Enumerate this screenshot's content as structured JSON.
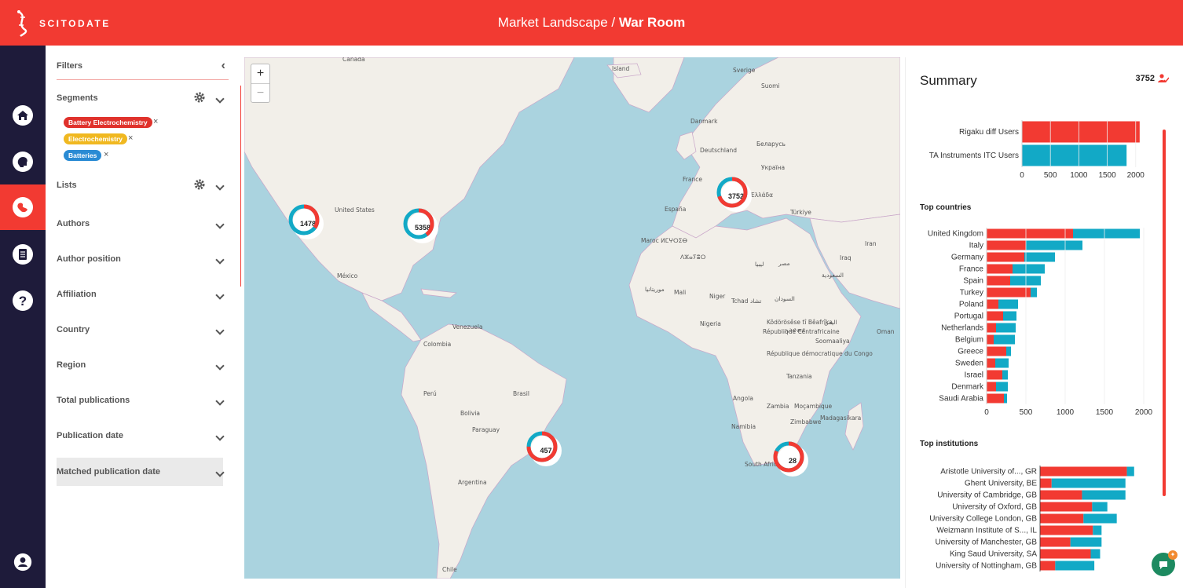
{
  "header": {
    "logo_text": "SCITODATE",
    "title_prefix": "Market Landscape / ",
    "title_main": "War Room"
  },
  "nav": {
    "items": [
      {
        "icon": "home-icon"
      },
      {
        "icon": "brain-icon"
      },
      {
        "icon": "globe-icon",
        "active": true
      },
      {
        "icon": "list-icon"
      },
      {
        "icon": "help-icon"
      },
      {
        "icon": "user-icon"
      }
    ]
  },
  "filters": {
    "title": "Filters",
    "collapse_symbol": "‹",
    "segments_label": "Segments",
    "tags": [
      {
        "label": "Battery Electrochemistry",
        "color": "#e0322c"
      },
      {
        "label": "Electrochemistry",
        "color": "#f0b820"
      },
      {
        "label": "Batteries",
        "color": "#2a8bd4"
      }
    ],
    "tag_remove": "×",
    "lists_label": "Lists",
    "rows": [
      "Authors",
      "Author position",
      "Affiliation",
      "Country",
      "Region",
      "Total publications",
      "Publication date"
    ],
    "matched_label": "Matched publication date"
  },
  "map": {
    "zoom_in": "+",
    "zoom_out": "−",
    "clusters": [
      {
        "value": "1478",
        "share": 0.35
      },
      {
        "value": "5358",
        "share": 0.4
      },
      {
        "value": "3752",
        "share": 0.7
      },
      {
        "value": "457",
        "share": 0.75
      },
      {
        "value": "28",
        "share": 0.82
      }
    ],
    "labels": [
      "Canada",
      "Island",
      "Sverige",
      "Suomi",
      "Danmark",
      "Deutschland",
      "Беларусь",
      "Україна",
      "France",
      "España",
      "Ελλάδα",
      "Türkiye",
      "United States",
      "México",
      "Maroc ⵍⵎⵖⵔⵉⴱ",
      "ⴷⵣⴰⵢⴻⵔ",
      "ليبيا",
      "مصر",
      "موريتانيا",
      "Mali",
      "Niger",
      "Tchad تشاد",
      "السودان",
      "السعودية",
      "اليمن",
      "Nigeria",
      "Kôdörösêse tî Bêafrîka",
      "République Centrafricaine",
      "ኢትዮጵያ",
      "Soomaaliya",
      "Venezuela",
      "Colombia",
      "Perú",
      "Brasil",
      "Bolivia",
      "Paraguay",
      "Argentina",
      "Chile",
      "République démocratique du Congo",
      "Tanzania",
      "Angola",
      "Zambia",
      "Moçambique",
      "Namibia",
      "Zimbabwe",
      "Madagasikara",
      "South Africa",
      "Iran",
      "Iraq",
      "Oman"
    ]
  },
  "summary": {
    "title": "Summary",
    "count": "3752",
    "colors": {
      "red": "#f23a32",
      "teal": "#12a9c6"
    },
    "users_chart": {
      "categories": [
        "Rigaku diff Users",
        "TA Instruments ITC Users"
      ],
      "values": [
        2070,
        1840
      ],
      "ticks": [
        0,
        500,
        1000,
        1500,
        2000
      ]
    },
    "countries_title": "Top countries",
    "institutions_title": "Top institutions"
  },
  "chart_data": [
    {
      "type": "bar",
      "categories": [
        "Rigaku diff Users",
        "TA Instruments ITC Users"
      ],
      "values": [
        2070,
        1840
      ],
      "xlim": [
        0,
        2100
      ]
    },
    {
      "type": "bar",
      "title": "Top countries",
      "categories": [
        "United Kingdom",
        "Italy",
        "Germany",
        "France",
        "Spain",
        "Turkey",
        "Poland",
        "Portugal",
        "Netherlands",
        "Belgium",
        "Greece",
        "Sweden",
        "Israel",
        "Denmark",
        "Saudi Arabia"
      ],
      "series": [
        {
          "values": [
            1100,
            500,
            480,
            330,
            300,
            560,
            150,
            210,
            120,
            90,
            250,
            110,
            200,
            120,
            220
          ]
        },
        {
          "values": [
            850,
            720,
            390,
            410,
            390,
            80,
            250,
            170,
            250,
            270,
            60,
            170,
            70,
            150,
            40
          ]
        }
      ],
      "xlim": [
        0,
        2100
      ],
      "ticks": [
        0,
        500,
        1000,
        1500,
        2000
      ]
    },
    {
      "type": "bar",
      "title": "Top institutions",
      "categories": [
        "Aristotle University of..., GR",
        "Ghent University, BE",
        "University of Cambridge, GB",
        "University of Oxford, GB",
        "University College London, GB",
        "Weizmann Institute of S..., IL",
        "University of Manchester, GB",
        "King Saud University, SA",
        "University of Nottingham, GB"
      ],
      "series": [
        {
          "values": [
            120,
            16,
            58,
            72,
            60,
            73,
            42,
            70,
            21
          ]
        },
        {
          "values": [
            10,
            102,
            60,
            21,
            46,
            12,
            43,
            13,
            54
          ]
        }
      ]
    }
  ]
}
